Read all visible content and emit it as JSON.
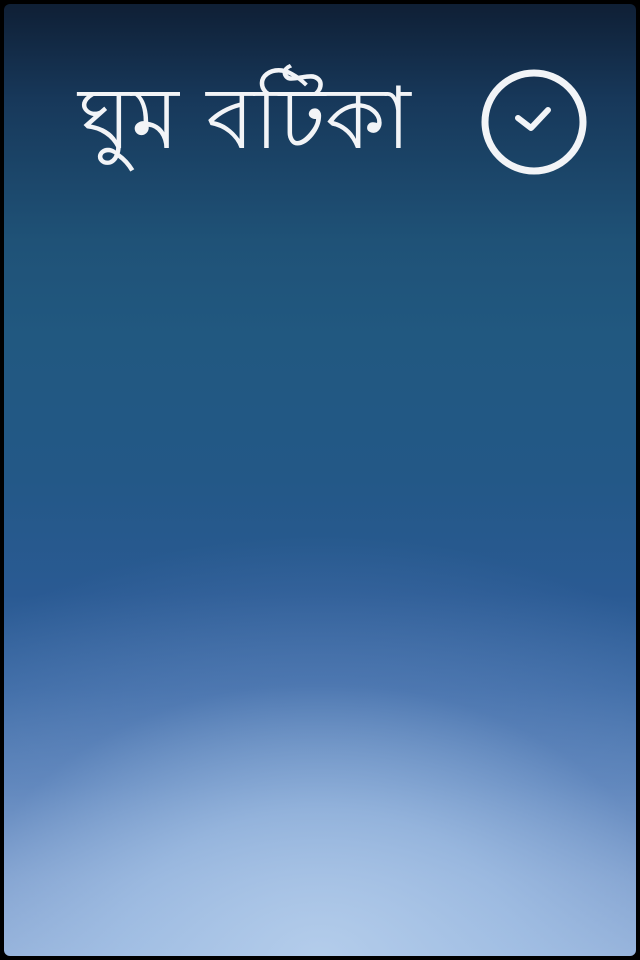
{
  "app": {
    "title": "ঘুম বটিকা",
    "status_icon": "clock-check-icon"
  },
  "colors": {
    "text": "#f2f4f7",
    "bg_top": "#0f1f35",
    "bg_mid": "#235887",
    "bg_bottom": "#a7c1e2"
  }
}
